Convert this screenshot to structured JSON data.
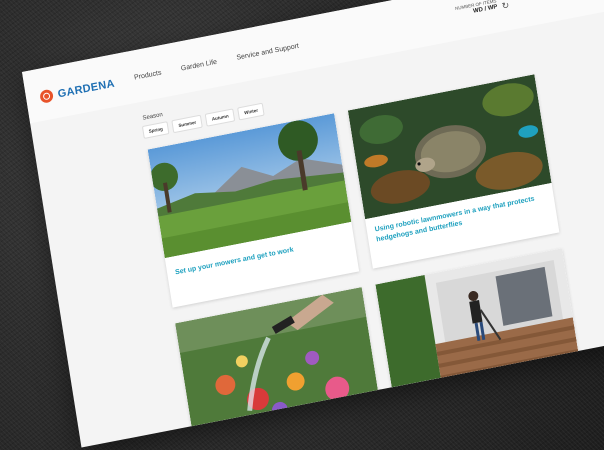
{
  "brand": {
    "name": "GARDENA"
  },
  "nav": {
    "items": [
      "Products",
      "Garden Life",
      "Service and Support"
    ]
  },
  "account": {
    "label": "NUMBER OF ITEMS",
    "value": "WD / WP"
  },
  "season": {
    "label": "Season",
    "tabs": [
      "Spring",
      "Summer",
      "Autumn",
      "Winter"
    ]
  },
  "cards": [
    {
      "caption": "Set up your mowers and get to work"
    },
    {
      "caption": "Using robotic lawnmowers in a way that protects hedgehogs and butterflies"
    },
    {
      "caption": ""
    },
    {
      "caption": ""
    }
  ],
  "colors": {
    "brand_orange": "#e8532a",
    "brand_blue": "#1e6fb3",
    "caption_teal": "#1fa1bf"
  },
  "icons": [
    "gardena-logo-icon",
    "refresh-icon",
    "search-icon"
  ]
}
